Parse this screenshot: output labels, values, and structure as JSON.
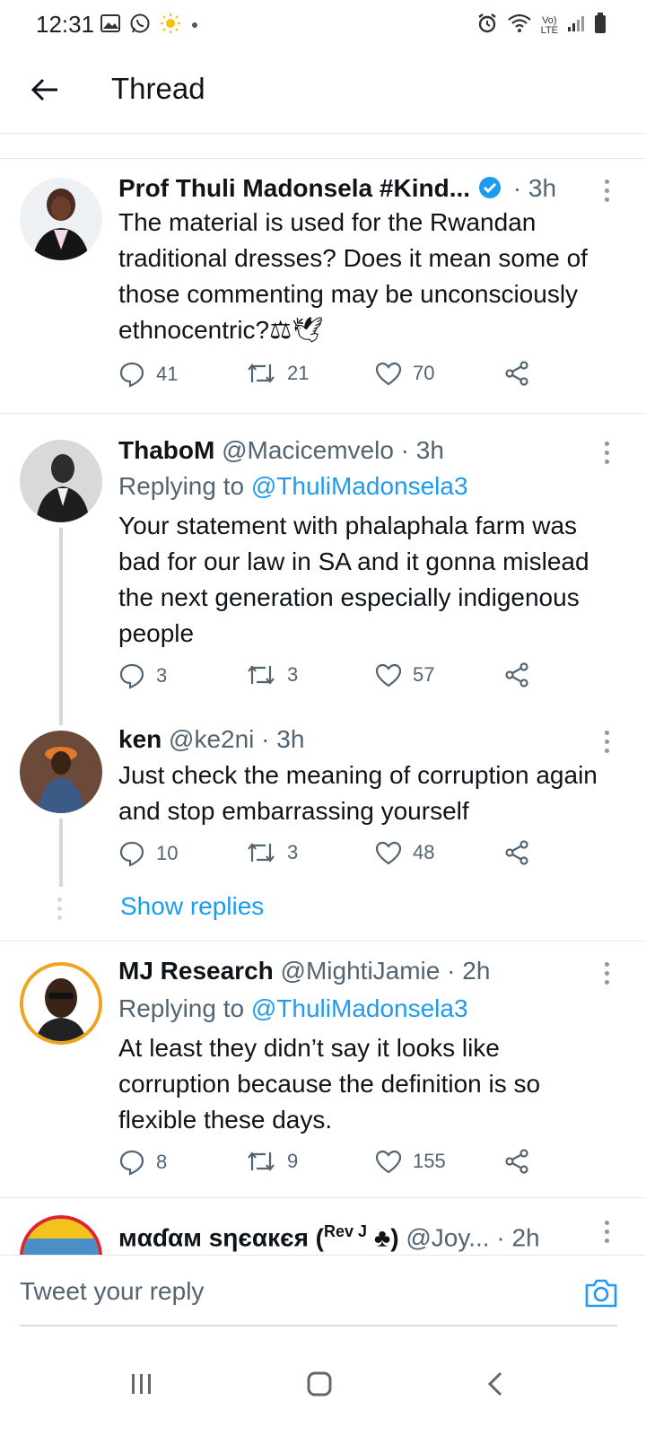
{
  "status_bar": {
    "time": "12:31",
    "left_icons": [
      "gallery-icon",
      "whatsapp-icon",
      "weather-sun-icon",
      "dot-icon"
    ],
    "right_icons": [
      "alarm-icon",
      "wifi-icon",
      "volte-icon",
      "signal-icon",
      "battery-icon"
    ],
    "volte_top": "Vo)",
    "volte_bottom": "LTE"
  },
  "header": {
    "title": "Thread",
    "back_icon": "arrow-left-icon"
  },
  "tweets": [
    {
      "name": "Prof Thuli Madonsela #Kind...",
      "handle": "",
      "time": "3h",
      "verified": true,
      "reply_label": "",
      "mention": "",
      "text": "The material is used for the Rwandan traditional dresses? Does it mean some of those commenting may be unconsciously ethnocentric?⚖🕊",
      "replies": "41",
      "retweets": "21",
      "likes": "70"
    },
    {
      "name": "ThaboM",
      "handle": "@Macicemvelo",
      "time": "3h",
      "verified": false,
      "reply_label": "Replying to",
      "mention": "@ThuliMadonsela3",
      "text": "Your statement with phalaphala farm was bad for our law in SA and it gonna mislead the next generation especially indigenous people",
      "replies": "3",
      "retweets": "3",
      "likes": "57"
    },
    {
      "name": "ken",
      "handle": "@ke2ni",
      "time": "3h",
      "verified": false,
      "reply_label": "",
      "mention": "",
      "text": "Just check the meaning of corruption again and stop embarrassing yourself",
      "replies": "10",
      "retweets": "3",
      "likes": "48"
    },
    {
      "name": "MJ Research",
      "handle": "@MightiJamie",
      "time": "2h",
      "verified": false,
      "reply_label": "Replying to",
      "mention": "@ThuliMadonsela3",
      "text": "At least they didn’t say it looks like corruption because the definition is so flexible these days.",
      "replies": "8",
      "retweets": "9",
      "likes": "155"
    },
    {
      "name": "мαɗαм ѕηєαкєя (",
      "name_sup": "Rev J",
      "name_suffix": " ♣)",
      "handle": "@Joy...",
      "time": "2h"
    }
  ],
  "show_replies": "Show replies",
  "reply_bar": {
    "placeholder": "Tweet your reply",
    "camera_icon": "camera-icon"
  },
  "nav_bar": {
    "icons": [
      "recent-apps-icon",
      "home-icon",
      "back-icon"
    ]
  },
  "colors": {
    "accent": "#1d9bf0",
    "text": "#0f1419",
    "secondary": "#536471"
  }
}
